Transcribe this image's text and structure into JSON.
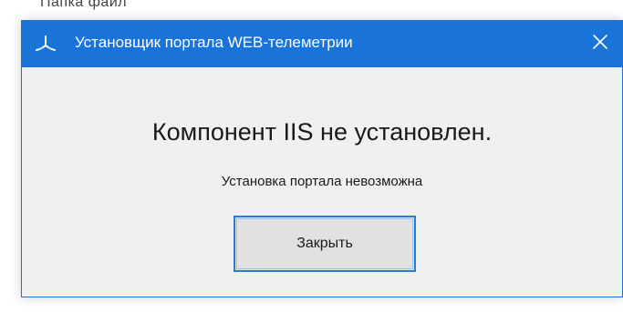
{
  "background": {
    "partial_text": "Папка файл"
  },
  "dialog": {
    "title": "Установщик портала WEB-телеметрии",
    "icon": "telemetry-app-icon",
    "close_icon": "close-icon",
    "message_title": "Компонент IIS не установлен.",
    "message_sub": "Установка портала невозможна",
    "close_button_label": "Закрыть",
    "accent_color": "#1a73d9"
  }
}
